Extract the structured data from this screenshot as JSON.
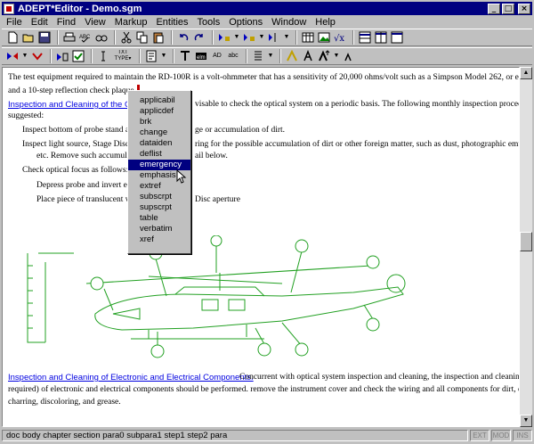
{
  "window": {
    "title": "ADEPT*Editor - Demo.sgm",
    "controls": [
      "_",
      "□",
      "×"
    ]
  },
  "menu": [
    "File",
    "Edit",
    "Find",
    "View",
    "Markup",
    "Entities",
    "Tools",
    "Options",
    "Window",
    "Help"
  ],
  "toolbar_icons": {
    "row1": [
      "new-file-icon",
      "open-folder-icon",
      "save-icon",
      "print-icon",
      "spell-check-icon",
      "find-icon",
      "cut-icon",
      "copy-icon",
      "paste-icon",
      "undo-icon",
      "redo-icon",
      "insert-element-icon",
      "change-element-icon",
      "split-element-icon",
      "table-icon",
      "graphic-icon",
      "equation-icon",
      "tile-horizontal-icon",
      "tile-vertical-icon",
      "cascade-icon"
    ],
    "row2": [
      "tag-show-icon",
      "tag-hide-icon",
      "validate-icon",
      "checkbox-icon",
      "cursor-icon",
      "type-icon",
      "text-icon",
      "attribute-icon",
      "insert-entity-icon",
      "ad-icon",
      "abc-icon",
      "sort-icon",
      "format-icon",
      "font-icon",
      "font-size-up-icon",
      "font-size-down-icon"
    ],
    "row2_labels": [
      "TXT",
      "TYPE▾",
      "AD",
      "abc"
    ]
  },
  "document": {
    "para1_line1": "The test equipment required to maintain the RD-100R is a volt-ohmmeter that has a sensitivity of 20,000 ohms/volt such as a Simpson Model 262, or equivalent,",
    "para1_line2": "and a 10-step reflection check plaque.",
    "heading1": "Inspection and Cleaning of the Op",
    "para2_rest": "visable to check the optical system on a periodic basis.  The following monthly inspection procedure is",
    "para2_line2": "suggested:",
    "step1": "Inspect bottom of probe stand and",
    "step1_rest": "ge or accumulation of dirt.",
    "step2": "Inspect light source, Stage Disc a",
    "step2_rest": "ring for the possible accumulation of dirt or other foreign matter, such as dust, photographic emulsion,",
    "step2_line2": "etc. Remove such accumulatio",
    "step2_line2_rest": "ail below.",
    "step3": "Check optical focus as follows:",
    "substep1": "Depress probe and invert ent",
    "substep2": "Place piece of translucent wh",
    "substep2_rest": "Disc aperture",
    "heading2": "Inspection and Cleaning of Electronic and Electrical Components.",
    "para3_line1": "Concurrent with optical system inspection and cleaning, the inspection and cleaning (if",
    "para3_line2": "required) of electronic and electrical components should be performed. remove the instrument cover and check the wiring and all components for dirt, corrosion,",
    "para3_line3": "charring, discoloring, and grease."
  },
  "element_menu": {
    "items": [
      "applicabil",
      "applicdef",
      "brk",
      "change",
      "dataiden",
      "deflist",
      "emergency",
      "emphasis",
      "extref",
      "subscrpt",
      "supscrpt",
      "table",
      "verbatim",
      "xref"
    ],
    "selected": "emergency"
  },
  "statusbar": {
    "path": "doc body chapter section para0 subpara1 step1 step2 para",
    "indicators": [
      "EXT",
      "MOD",
      "INS"
    ]
  },
  "colors": {
    "title_bg": "#000080",
    "link": "#0000e0",
    "drawing": "#22a022",
    "selection": "#000080"
  }
}
